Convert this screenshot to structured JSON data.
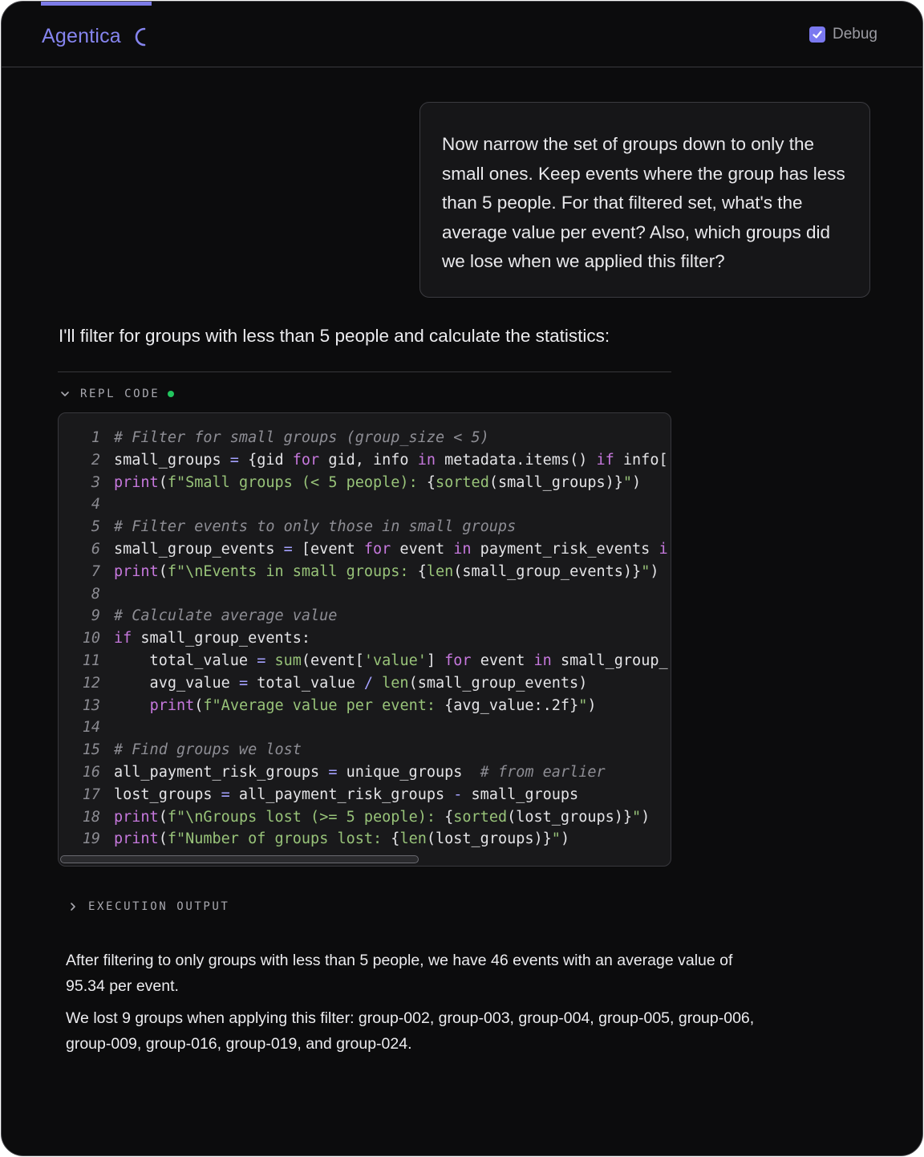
{
  "header": {
    "brand": "Agentica",
    "spinner_icon": "loading-spinner-icon",
    "debug_label": "Debug",
    "debug_checked": true,
    "accent_color": "#7d7ce8"
  },
  "user_message": "Now narrow the set of groups down to only the small ones. Keep events where the group has less than 5 people. For that filtered set, what's the average value per event? Also, which groups did we lose when we applied this filter?",
  "assistant_intro": "I'll filter for groups with less than 5 people and calculate the statistics:",
  "repl": {
    "label": "REPL CODE",
    "status_color": "#22c55e",
    "lines": [
      {
        "n": "1",
        "tokens": [
          [
            "c",
            "# Filter for small groups (group_size < 5)"
          ]
        ]
      },
      {
        "n": "2",
        "tokens": [
          [
            "p",
            "small_groups "
          ],
          [
            "o",
            "="
          ],
          [
            "p",
            " {gid "
          ],
          [
            "k",
            "for"
          ],
          [
            "p",
            " gid, info "
          ],
          [
            "k",
            "in"
          ],
          [
            "p",
            " metadata.items() "
          ],
          [
            "k",
            "if"
          ],
          [
            "p",
            " info["
          ]
        ]
      },
      {
        "n": "3",
        "tokens": [
          [
            "k",
            "print"
          ],
          [
            "p",
            "("
          ],
          [
            "s",
            "f\"Small groups (< 5 people): "
          ],
          [
            "p",
            "{"
          ],
          [
            "f",
            "sorted"
          ],
          [
            "p",
            "(small_groups)}"
          ],
          [
            "s",
            "\""
          ],
          [
            "p",
            ")"
          ]
        ]
      },
      {
        "n": "4",
        "tokens": []
      },
      {
        "n": "5",
        "tokens": [
          [
            "c",
            "# Filter events to only those in small groups"
          ]
        ]
      },
      {
        "n": "6",
        "tokens": [
          [
            "p",
            "small_group_events "
          ],
          [
            "o",
            "="
          ],
          [
            "p",
            " [event "
          ],
          [
            "k",
            "for"
          ],
          [
            "p",
            " event "
          ],
          [
            "k",
            "in"
          ],
          [
            "p",
            " payment_risk_events "
          ],
          [
            "k",
            "i"
          ]
        ]
      },
      {
        "n": "7",
        "tokens": [
          [
            "k",
            "print"
          ],
          [
            "p",
            "("
          ],
          [
            "s",
            "f\"\\nEvents in small groups: "
          ],
          [
            "p",
            "{"
          ],
          [
            "f",
            "len"
          ],
          [
            "p",
            "(small_group_events)}"
          ],
          [
            "s",
            "\""
          ],
          [
            "p",
            ")"
          ]
        ]
      },
      {
        "n": "8",
        "tokens": []
      },
      {
        "n": "9",
        "tokens": [
          [
            "c",
            "# Calculate average value"
          ]
        ]
      },
      {
        "n": "10",
        "tokens": [
          [
            "k",
            "if"
          ],
          [
            "p",
            " small_group_events:"
          ]
        ]
      },
      {
        "n": "11",
        "tokens": [
          [
            "p",
            "    total_value "
          ],
          [
            "o",
            "="
          ],
          [
            "p",
            " "
          ],
          [
            "f",
            "sum"
          ],
          [
            "p",
            "(event["
          ],
          [
            "s",
            "'value'"
          ],
          [
            "p",
            "] "
          ],
          [
            "k",
            "for"
          ],
          [
            "p",
            " event "
          ],
          [
            "k",
            "in"
          ],
          [
            "p",
            " small_group_"
          ]
        ]
      },
      {
        "n": "12",
        "tokens": [
          [
            "p",
            "    avg_value "
          ],
          [
            "o",
            "="
          ],
          [
            "p",
            " total_value "
          ],
          [
            "o",
            "/"
          ],
          [
            "p",
            " "
          ],
          [
            "f",
            "len"
          ],
          [
            "p",
            "(small_group_events)"
          ]
        ]
      },
      {
        "n": "13",
        "tokens": [
          [
            "p",
            "    "
          ],
          [
            "k",
            "print"
          ],
          [
            "p",
            "("
          ],
          [
            "s",
            "f\"Average value per event: "
          ],
          [
            "p",
            "{avg_value:.2f}"
          ],
          [
            "s",
            "\""
          ],
          [
            "p",
            ")"
          ]
        ]
      },
      {
        "n": "14",
        "tokens": []
      },
      {
        "n": "15",
        "tokens": [
          [
            "c",
            "# Find groups we lost"
          ]
        ]
      },
      {
        "n": "16",
        "tokens": [
          [
            "p",
            "all_payment_risk_groups "
          ],
          [
            "o",
            "="
          ],
          [
            "p",
            " unique_groups  "
          ],
          [
            "c",
            "# from earlier"
          ]
        ]
      },
      {
        "n": "17",
        "tokens": [
          [
            "p",
            "lost_groups "
          ],
          [
            "o",
            "="
          ],
          [
            "p",
            " all_payment_risk_groups "
          ],
          [
            "o",
            "-"
          ],
          [
            "p",
            " small_groups"
          ]
        ]
      },
      {
        "n": "18",
        "tokens": [
          [
            "k",
            "print"
          ],
          [
            "p",
            "("
          ],
          [
            "s",
            "f\"\\nGroups lost (>= 5 people): "
          ],
          [
            "p",
            "{"
          ],
          [
            "f",
            "sorted"
          ],
          [
            "p",
            "(lost_groups)}"
          ],
          [
            "s",
            "\""
          ],
          [
            "p",
            ")"
          ]
        ]
      },
      {
        "n": "19",
        "tokens": [
          [
            "k",
            "print"
          ],
          [
            "p",
            "("
          ],
          [
            "s",
            "f\"Number of groups lost: "
          ],
          [
            "p",
            "{"
          ],
          [
            "f",
            "len"
          ],
          [
            "p",
            "(lost_groups)}"
          ],
          [
            "s",
            "\""
          ],
          [
            "p",
            ")"
          ]
        ]
      }
    ]
  },
  "execution_output": {
    "label": "EXECUTION OUTPUT",
    "expanded": false
  },
  "answer": {
    "p1": "After filtering to only groups with less than 5 people, we have 46 events with an average value of 95.34 per event.",
    "p2": "We lost 9 groups when applying this filter: group-002, group-003, group-004, group-005, group-006, group-009, group-016, group-019, and group-024."
  }
}
